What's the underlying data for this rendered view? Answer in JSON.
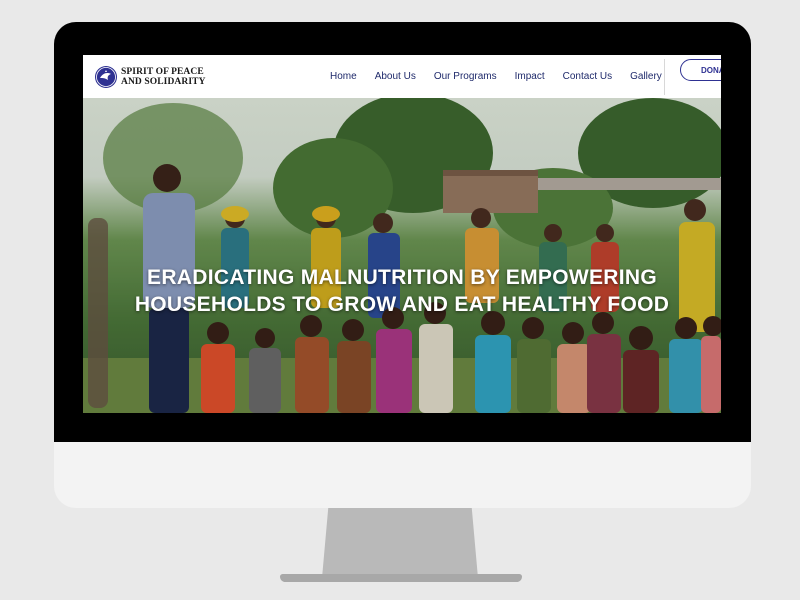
{
  "site": {
    "logo_line1": "SPIRIT OF PEACE",
    "logo_line2": "AND SOLIDARITY",
    "brand_color": "#2e3192"
  },
  "nav": {
    "items": [
      "Home",
      "About Us",
      "Our Programs",
      "Impact",
      "Contact Us",
      "Gallery"
    ],
    "donate_label": "DONA"
  },
  "hero": {
    "title_line1": "ERADICATING MALNUTRITION BY EMPOWERING",
    "title_line2": "HOUSEHOLDS TO GROW AND EAT HEALTHY FOOD",
    "image_subject": "group-photo-adults-and-children-outdoors"
  }
}
